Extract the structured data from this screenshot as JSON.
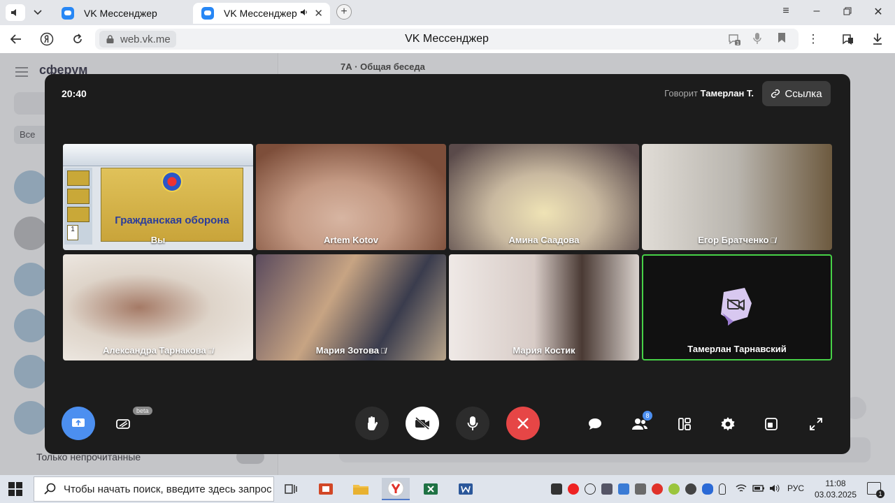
{
  "browser": {
    "tabs": [
      {
        "title": "VK Мессенджер",
        "active": false
      },
      {
        "title": "VK Мессенджер",
        "active": true
      }
    ],
    "address": "web.vk.me",
    "page_title": "VK Мессенджер"
  },
  "vk": {
    "logo": "сферум",
    "filter_chip": "Все",
    "chat_header": "7А · Общая беседа",
    "unread_toggle_label": "Только непрочитанные"
  },
  "call": {
    "time": "20:40",
    "speaking_prefix": "Говорит",
    "speaking_name": "Тамерлан Т.",
    "link_button": "Ссылка",
    "participants": [
      {
        "name": "Вы",
        "muted": false,
        "screen_share": true
      },
      {
        "name": "Artem Kotov",
        "muted": false
      },
      {
        "name": "Амина Саадова",
        "muted": false
      },
      {
        "name": "Егор Братченко",
        "muted": true
      },
      {
        "name": "Александра Тарнакова",
        "muted": true
      },
      {
        "name": "Мария Зотова",
        "muted": true
      },
      {
        "name": "Мария Костик",
        "muted": false
      },
      {
        "name": "Тамерлан Тарнавский",
        "muted": false,
        "camera_off": true,
        "speaking": true
      }
    ],
    "slide_title": "Гражданская оборона",
    "slide_number": "1",
    "beta_label": "beta",
    "participants_count": "8",
    "accent_color": "#4c8ff0",
    "end_color": "#e64646",
    "speaker_border_color": "#47d147"
  },
  "taskbar": {
    "search_placeholder": "Чтобы начать поиск, введите здесь запрос",
    "language": "РУС",
    "time": "11:08",
    "date": "03.03.2025",
    "notifications": "1"
  }
}
